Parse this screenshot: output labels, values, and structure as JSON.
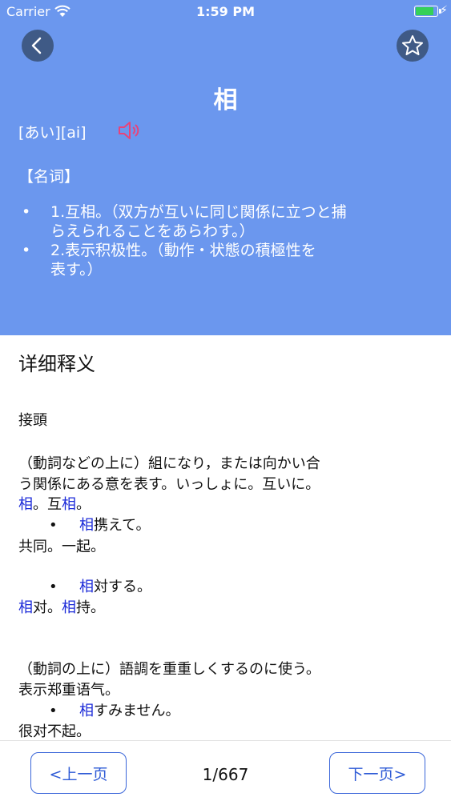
{
  "status": {
    "carrier": "Carrier",
    "time": "1:59 PM"
  },
  "header": {
    "word": "相",
    "reading": "[あい][ai]",
    "part_of_speech": "【名词】",
    "definitions": [
      {
        "line1": "1.互相。（双方が互いに同じ関係に立つと捕",
        "line2": "らえられることをあらわす。）"
      },
      {
        "line1": "2.表示积极性。（動作・状態の積極性を",
        "line2": "表す。）"
      }
    ]
  },
  "detail": {
    "title": "详细释义",
    "prefix_label": "接頭",
    "p1_line1": "（動詞などの上に）組になり，または向かい合",
    "p1_line2": "う関係にある意を表す。いっしょに。互いに。",
    "p1_line3": {
      "a": "相",
      "b": "。互",
      "c": "相",
      "d": "。"
    },
    "ex1": {
      "hl": "相",
      "rest": "携えて。"
    },
    "ex1_trans": "共同。一起。",
    "ex2": {
      "hl": "相",
      "rest": "対する。"
    },
    "ex2_trans": {
      "a": "相",
      "b": "对。",
      "c": "相",
      "d": "持。"
    },
    "p2_line1": "（動詞の上に）語調を重重しくするのに使う。",
    "p2_line2": "表示郑重语气。",
    "ex3": {
      "hl": "相",
      "rest": "すみません。"
    },
    "ex3_trans": "很对不起。"
  },
  "footer": {
    "prev_label": "<上一页",
    "next_label": "下一页>",
    "page_indicator": "1/667"
  },
  "colors": {
    "header_bg": "#6B97EE",
    "accent": "#2d5ad6",
    "highlight": "#1b2ad8",
    "speaker": "#e8437a"
  },
  "icons": {
    "back": "chevron-left-icon",
    "favorite": "star-outline-icon",
    "audio": "speaker-icon"
  }
}
